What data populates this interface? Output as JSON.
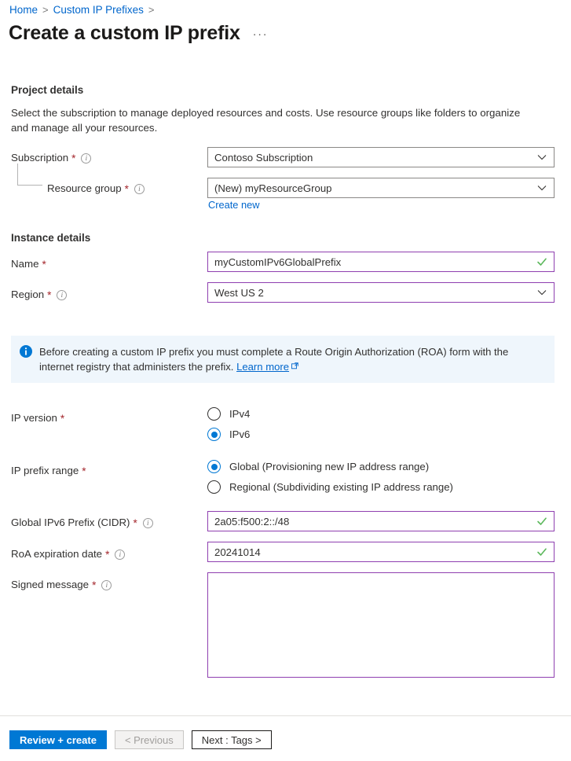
{
  "breadcrumb": {
    "items": [
      {
        "label": "Home"
      },
      {
        "label": "Custom IP Prefixes"
      }
    ],
    "separator": ">"
  },
  "header": {
    "title": "Create a custom IP prefix",
    "more_actions": "···"
  },
  "project_details": {
    "heading": "Project details",
    "description": "Select the subscription to manage deployed resources and costs. Use resource groups like folders to organize and manage all your resources.",
    "subscription": {
      "label": "Subscription",
      "required": "*",
      "info": "i",
      "value": "Contoso Subscription"
    },
    "resource_group": {
      "label": "Resource group",
      "required": "*",
      "info": "i",
      "value": "(New) myResourceGroup",
      "create_new_link": "Create new"
    }
  },
  "instance_details": {
    "heading": "Instance details",
    "name": {
      "label": "Name",
      "required": "*",
      "value": "myCustomIPv6GlobalPrefix"
    },
    "region": {
      "label": "Region",
      "required": "*",
      "info": "i",
      "value": "West US 2"
    }
  },
  "banner": {
    "icon": "info-circle-icon",
    "text_before_link": "Before creating a custom IP prefix you must complete a Route Origin Authorization (ROA) form with the internet registry that administers the prefix. ",
    "link_label": "Learn more",
    "external_icon": "external-link-icon",
    "background": "#eff6fc",
    "accent": "#0078d4"
  },
  "ip_version": {
    "label": "IP version",
    "required": "*",
    "options": [
      {
        "label": "IPv4",
        "selected": false
      },
      {
        "label": "IPv6",
        "selected": true
      }
    ]
  },
  "ip_prefix_range": {
    "label": "IP prefix range",
    "required": "*",
    "options": [
      {
        "label": "Global (Provisioning new IP address range)",
        "selected": true
      },
      {
        "label": "Regional (Subdividing existing IP address range)",
        "selected": false
      }
    ]
  },
  "global_prefix": {
    "label": "Global IPv6 Prefix (CIDR)",
    "required": "*",
    "info": "i",
    "value": "2a05:f500:2::/48"
  },
  "roa_expiration": {
    "label": "RoA expiration date",
    "required": "*",
    "info": "i",
    "value": "20241014"
  },
  "signed_message": {
    "label": "Signed message",
    "required": "*",
    "info": "i",
    "value": "",
    "placeholder": ""
  },
  "footer": {
    "review_create": "Review + create",
    "previous": "< Previous",
    "next": "Next : Tags >"
  },
  "colors": {
    "link": "#0066cc",
    "primary_button": "#0078d4",
    "required_asterisk": "#a4262c",
    "validated_border": "#8f3fb0",
    "valid_check": "#5cb85c",
    "control_border": "#8a8886"
  }
}
